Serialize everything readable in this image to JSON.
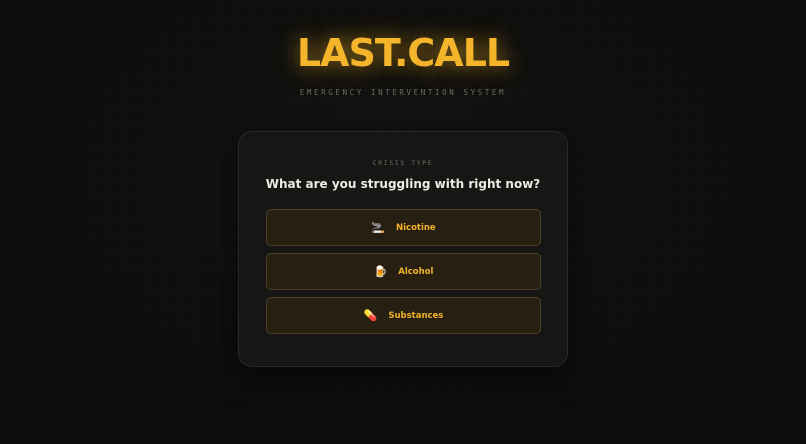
{
  "app": {
    "title": "LAST.CALL",
    "tagline": "EMERGENCY INTERVENTION SYSTEM"
  },
  "card": {
    "label": "CRISIS TYPE",
    "question": "What are you struggling with right now?",
    "options": [
      {
        "icon": "🚬",
        "icon_name": "cigarette-icon",
        "label": "Nicotine"
      },
      {
        "icon": "🍺",
        "icon_name": "beer-mug-icon",
        "label": "Alcohol"
      },
      {
        "icon": "💊",
        "icon_name": "pill-icon",
        "label": "Substances"
      }
    ]
  },
  "colors": {
    "accent": "#f4b52a",
    "background": "#0d0d0c",
    "card": "#161614",
    "option_bg": "#261f12",
    "option_border": "#4a3f22"
  }
}
